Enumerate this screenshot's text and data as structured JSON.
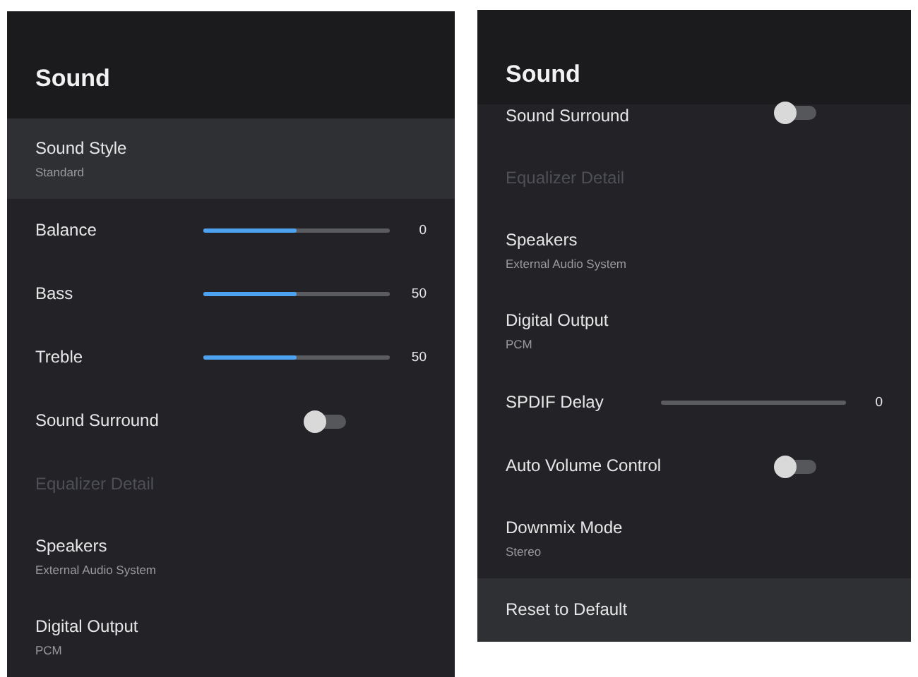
{
  "panels": [
    {
      "title": "Sound",
      "items": [
        {
          "kind": "choice",
          "label": "Sound Style",
          "value": "Standard",
          "selected": true,
          "disabled": false,
          "clipped": false
        },
        {
          "kind": "slider",
          "label": "Balance",
          "level": 0.5,
          "reading": "0",
          "selected": false,
          "disabled": false,
          "clipped": false
        },
        {
          "kind": "slider",
          "label": "Bass",
          "level": 0.5,
          "reading": "50",
          "selected": false,
          "disabled": false,
          "clipped": false
        },
        {
          "kind": "slider",
          "label": "Treble",
          "level": 0.5,
          "reading": "50",
          "selected": false,
          "disabled": false,
          "clipped": false
        },
        {
          "kind": "toggle",
          "label": "Sound Surround",
          "on": false,
          "selected": false,
          "disabled": false,
          "clipped": false
        },
        {
          "kind": "link",
          "label": "Equalizer Detail",
          "selected": false,
          "disabled": true,
          "clipped": false
        },
        {
          "kind": "choice",
          "label": "Speakers",
          "value": "External Audio System",
          "selected": false,
          "disabled": false,
          "clipped": false
        },
        {
          "kind": "choice",
          "label": "Digital Output",
          "value": "PCM",
          "selected": false,
          "disabled": false,
          "clipped": false
        }
      ]
    },
    {
      "title": "Sound",
      "items": [
        {
          "kind": "toggle",
          "label": "Sound Surround",
          "on": false,
          "selected": false,
          "disabled": false,
          "clipped": true
        },
        {
          "kind": "link",
          "label": "Equalizer Detail",
          "selected": false,
          "disabled": true,
          "clipped": false
        },
        {
          "kind": "choice",
          "label": "Speakers",
          "value": "External Audio System",
          "selected": false,
          "disabled": false,
          "clipped": false
        },
        {
          "kind": "choice",
          "label": "Digital Output",
          "value": "PCM",
          "selected": false,
          "disabled": false,
          "clipped": false
        },
        {
          "kind": "slider",
          "label": "SPDIF Delay",
          "level": 0,
          "reading": "0",
          "selected": false,
          "disabled": false,
          "clipped": false
        },
        {
          "kind": "toggle",
          "label": "Auto Volume Control",
          "on": false,
          "selected": false,
          "disabled": false,
          "clipped": false
        },
        {
          "kind": "choice",
          "label": "Downmix Mode",
          "value": "Stereo",
          "selected": false,
          "disabled": false,
          "clipped": false
        },
        {
          "kind": "link",
          "label": "Reset to Default",
          "selected": true,
          "disabled": false,
          "clipped": false
        }
      ]
    }
  ]
}
